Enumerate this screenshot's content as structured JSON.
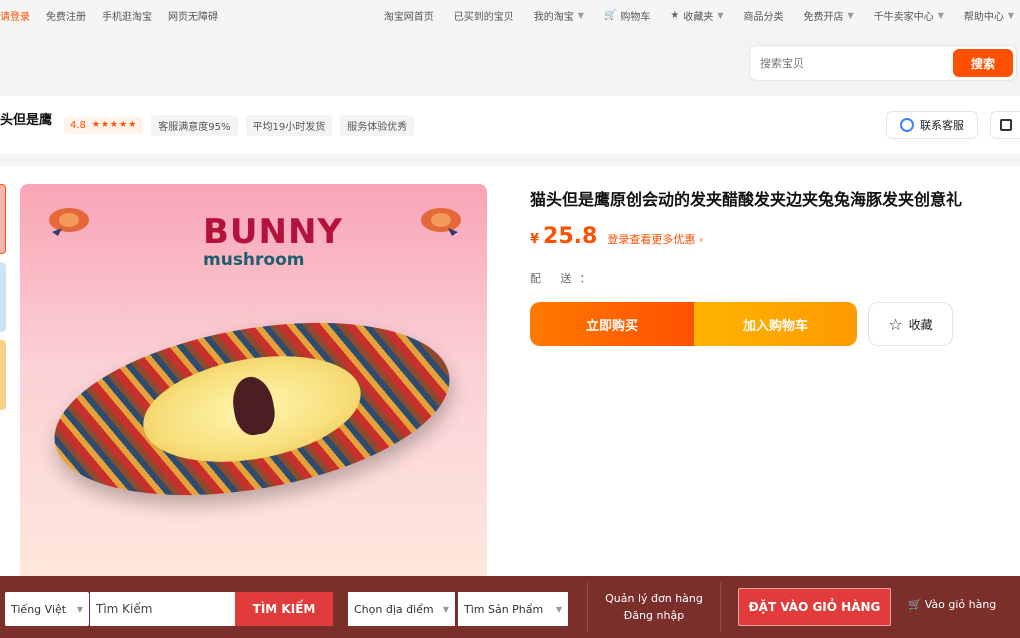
{
  "topbar": {
    "login": "请登录",
    "register": "免费注册",
    "mobile": "手机逛淘宝",
    "accessible": "网页无障碍",
    "home": "淘宝网首页",
    "bought": "已买到的宝贝",
    "my_taobao": "我的淘宝",
    "cart": "购物车",
    "favorites": "收藏夹",
    "categories": "商品分类",
    "open_shop": "免费开店",
    "seller_center": "千牛卖家中心",
    "help": "帮助中心"
  },
  "search": {
    "placeholder": "搜索宝贝",
    "button": "搜索"
  },
  "shop": {
    "name": "头但是鹰",
    "rating": "4.8",
    "stars": "★★★★★",
    "tag1": "客服满意度95%",
    "tag2": "平均19小时发货",
    "tag3": "服务体验优秀",
    "service": "联系客服"
  },
  "product": {
    "image_title": "BUNNY",
    "image_subtitle": "mushroom",
    "title": "猫头但是鹰原创会动的发夹醋酸发夹边夹兔兔海豚发夹创意礼",
    "currency": "¥",
    "price": "25.8",
    "promo": "登录查看更多优惠 ›",
    "delivery": "配 送：",
    "buy_now": "立即购买",
    "add_cart": "加入购物车",
    "favorite": "收藏"
  },
  "overlay": {
    "language": "Tiếng Việt",
    "search_value": "Tìm Kiếm",
    "search_button": "TÌM KIẾM",
    "location": "Chọn địa điểm",
    "product_type": "Tìm Sản Phẩm",
    "manage_orders": "Quản lý đơn hàng",
    "login": "Đăng nhập",
    "place_order": "ĐẶT VÀO GIỎ HÀNG",
    "cart": "Vào giỏ hàng"
  },
  "colors": {
    "accent": "#ff5000",
    "overlay_bg": "#7a2f2a",
    "overlay_button": "#e23b3b"
  }
}
